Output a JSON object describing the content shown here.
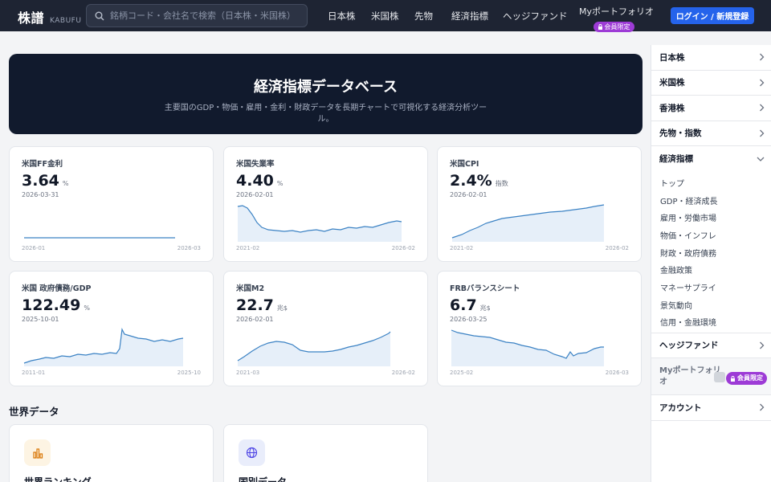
{
  "header": {
    "brand": "株譜",
    "brand_sub": "KABUFU",
    "search_placeholder": "銘柄コード・会社名で検索（日本株・米国株）",
    "nav": [
      "日本株",
      "米国株",
      "先物",
      "経済指標",
      "ヘッジファンド"
    ],
    "portfolio_label": "Myポートフォリオ",
    "member_badge": "会員限定",
    "login_label": "ログイン / 新規登録"
  },
  "hero": {
    "title": "経済指標データベース",
    "description": "主要国のGDP・物価・雇用・金利・財政データを長期チャートで可視化する経済分析ツール。"
  },
  "cards": [
    {
      "title": "米国FF金利",
      "value": "3.64",
      "unit": "%",
      "date": "2026-03-31",
      "x_start": "2026-01",
      "x_end": "2026-03"
    },
    {
      "title": "米国失業率",
      "value": "4.40",
      "unit": "%",
      "date": "2026-02-01",
      "x_start": "2021-02",
      "x_end": "2026-02"
    },
    {
      "title": "米国CPI",
      "value": "2.4%",
      "unit": "指数",
      "date": "2026-02-01",
      "x_start": "2021-02",
      "x_end": "2026-02"
    },
    {
      "title": "米国 政府債務/GDP",
      "value": "122.49",
      "unit": "%",
      "date": "2025-10-01",
      "x_start": "2011-01",
      "x_end": "2025-10"
    },
    {
      "title": "米国M2",
      "value": "22.7",
      "unit": "兆$",
      "date": "2026-02-01",
      "x_start": "2021-03",
      "x_end": "2026-02"
    },
    {
      "title": "FRBバランスシート",
      "value": "6.7",
      "unit": "兆$",
      "date": "2026-03-25",
      "x_start": "2025-02",
      "x_end": "2026-03"
    }
  ],
  "world": {
    "section_title": "世界データ",
    "items": [
      {
        "label": "世界ランキング",
        "icon": "bar-chart-icon"
      },
      {
        "label": "国別データ",
        "icon": "globe-icon"
      }
    ]
  },
  "sidebar": {
    "items": [
      "日本株",
      "米国株",
      "香港株",
      "先物・指数",
      "経済指標"
    ],
    "sub_items": [
      "トップ",
      "GDP・経済成長",
      "雇用・労働市場",
      "物価・インフレ",
      "財政・政府債務",
      "金融政策",
      "マネーサプライ",
      "景気動向",
      "信用・金融環境"
    ],
    "hedge_fund": "ヘッジファンド",
    "portfolio": "Myポートフォリオ",
    "account": "アカウント"
  },
  "colors": {
    "header_bg": "#1e2433",
    "hero_bg": "#111a2d",
    "accent": "#2563eb",
    "line": "#3b82c4",
    "badge": "#9d3bd6"
  }
}
